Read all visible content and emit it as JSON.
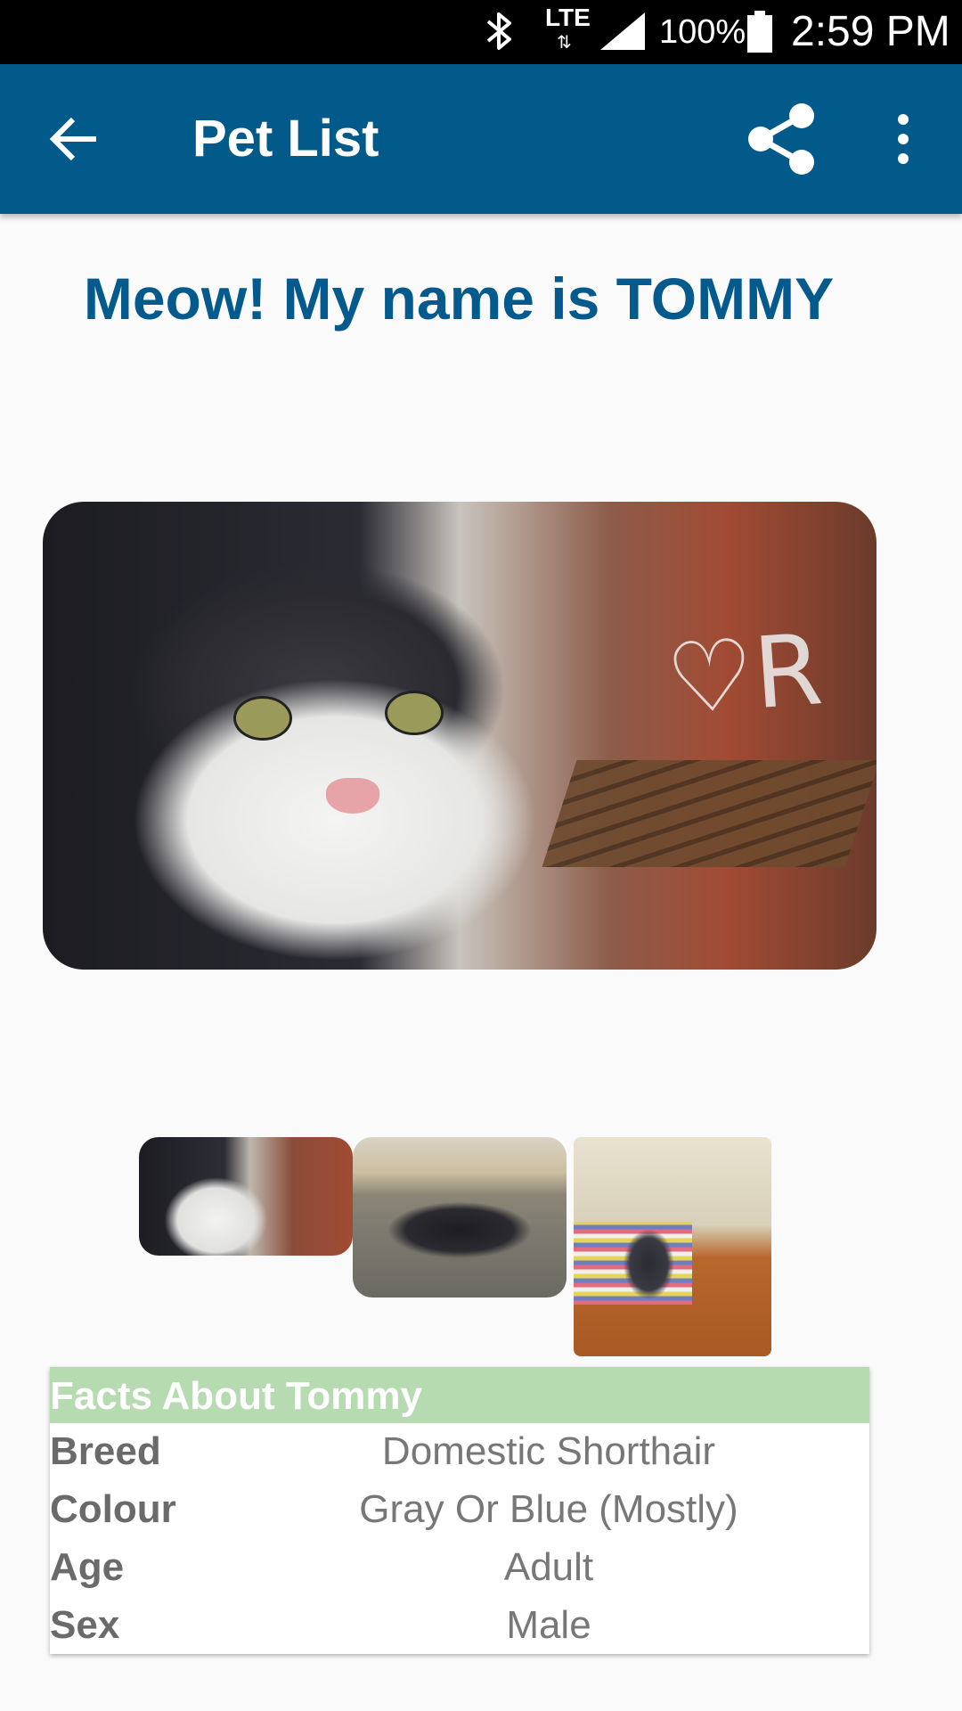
{
  "status_bar": {
    "network": "LTE",
    "battery_percent": "100%",
    "battery_level": 1.0,
    "time": "2:59 PM",
    "icons": [
      "bluetooth-icon",
      "lte-data-icon",
      "signal-strength-icon",
      "battery-icon"
    ]
  },
  "app_bar": {
    "title": "Pet List",
    "background_color": "#025a8a",
    "icons": [
      "back-arrow-icon",
      "share-icon",
      "more-vert-icon"
    ]
  },
  "headline": "Meow! My name is TOMMY",
  "headline_color": "#045a8c",
  "facts": {
    "header": "Facts About Tommy",
    "header_color": "#b7dbb0",
    "rows": [
      {
        "label": "Breed",
        "value": "Domestic Shorthair"
      },
      {
        "label": "Colour",
        "value": "Gray Or Blue (Mostly)"
      },
      {
        "label": "Age",
        "value": "Adult"
      },
      {
        "label": "Sex",
        "value": "Male"
      }
    ]
  }
}
